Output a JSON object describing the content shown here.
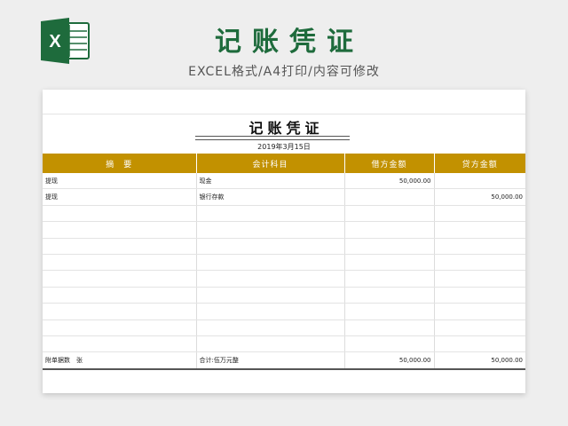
{
  "banner": {
    "title": "记账凭证",
    "subtitle": "EXCEL格式/A4打印/内容可修改",
    "logo_icon": "excel-icon",
    "accent": "#1e6b3c"
  },
  "voucher": {
    "title": "记账凭证",
    "date": "2019年3月15日",
    "header_color": "#c29100",
    "columns": [
      "摘　要",
      "会计科目",
      "借方金额",
      "贷方金额"
    ],
    "rows": [
      [
        "提现",
        "现金",
        "50,000.00",
        ""
      ],
      [
        "提现",
        "银行存款",
        "",
        "50,000.00"
      ],
      [
        "",
        "",
        "",
        ""
      ],
      [
        "",
        "",
        "",
        ""
      ],
      [
        "",
        "",
        "",
        ""
      ],
      [
        "",
        "",
        "",
        ""
      ],
      [
        "",
        "",
        "",
        ""
      ],
      [
        "",
        "",
        "",
        ""
      ],
      [
        "",
        "",
        "",
        ""
      ],
      [
        "",
        "",
        "",
        ""
      ],
      [
        "",
        "",
        "",
        ""
      ]
    ],
    "total": {
      "attachment": "附单据数　张",
      "sum_label": "合计:伍万元整",
      "debit": "50,000.00",
      "credit": "50,000.00"
    }
  }
}
